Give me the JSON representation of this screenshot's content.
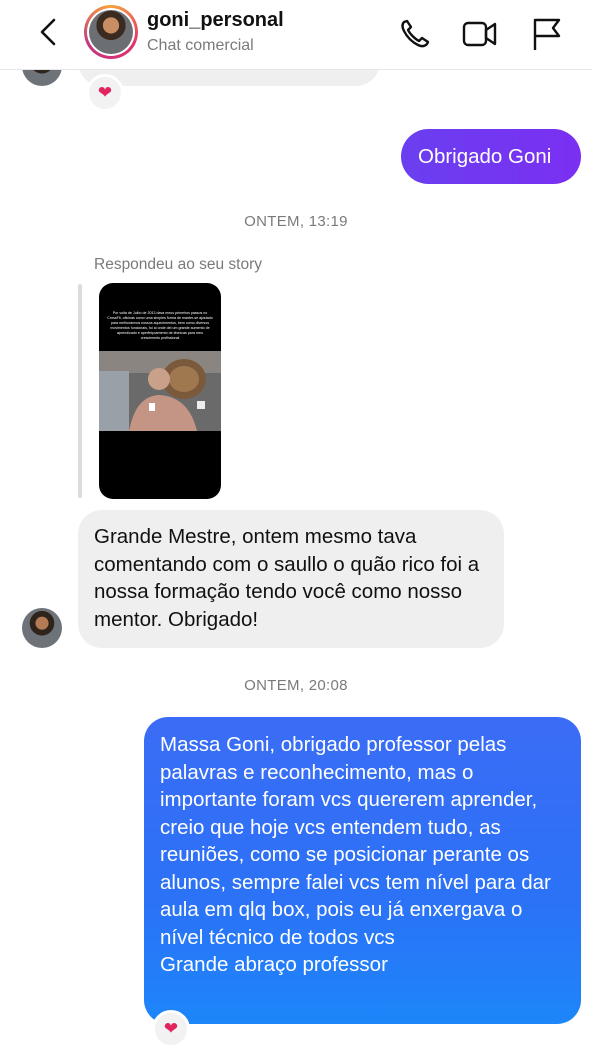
{
  "header": {
    "username": "goni_personal",
    "subtitle": "Chat comercial",
    "icons": [
      "back-arrow-icon",
      "phone-icon",
      "video-camera-icon",
      "flag-icon"
    ]
  },
  "messages": {
    "sent_1": "Obrigado Goni",
    "timestamp_1": "ONTEM, 13:19",
    "story_reply_label": "Respondeu ao seu story",
    "story_text": "Por volta de Julho de 2013 dava meus primeiros passos no CrossFit, oficinas como uma simples forma de manter-se ajustado para melhorarmos nossos aquecimentos, bem como diversos movimentos funcionais, foi aí onde dei um grande aumento de aprendizado e aperfeiçoamento de técnicas para meu crescimento profissional",
    "received_1": "Grande Mestre, ontem mesmo tava comentando com o saullo o quão rico foi a nossa formação tendo você como nosso mentor. Obrigado!",
    "timestamp_2": "ONTEM, 20:08",
    "sent_2": "Massa Goni, obrigado professor pelas palavras e reconhecimento, mas o importante foram vcs quererem aprender, creio que hoje vcs entendem tudo, as reuniões, como se posicionar perante os alunos, sempre falei vcs tem nível para dar aula em qlq box, pois eu já enxergava o nível técnico de todos vcs",
    "sent_2_b": "Grande abraço professor",
    "reaction": "❤️"
  },
  "colors": {
    "purple_bubble": "#6f3af1",
    "blue_bubble": "#2b72f7",
    "gray_bubble": "#efefef"
  }
}
